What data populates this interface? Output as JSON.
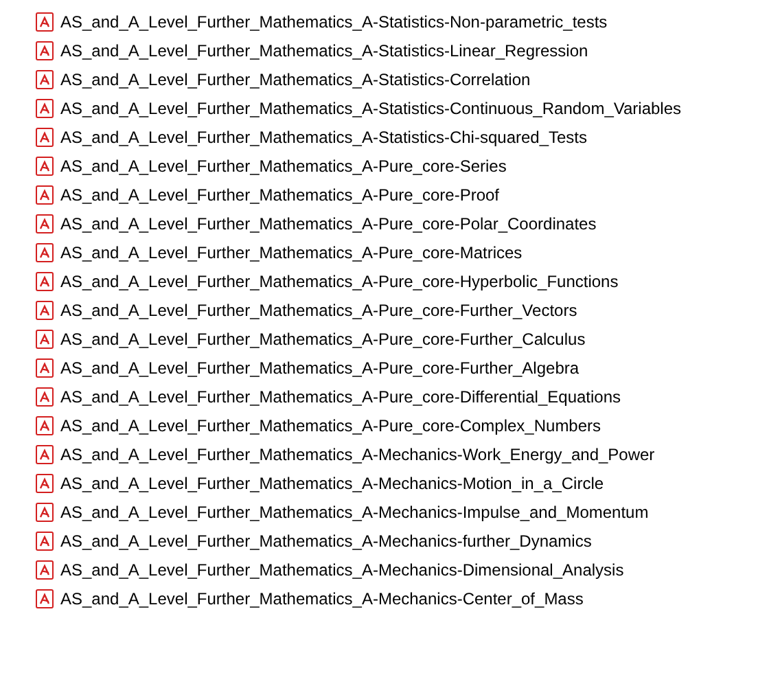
{
  "files": [
    {
      "name": "AS_and_A_Level_Further_Mathematics_A-Statistics-Non-parametric_tests"
    },
    {
      "name": "AS_and_A_Level_Further_Mathematics_A-Statistics-Linear_Regression"
    },
    {
      "name": "AS_and_A_Level_Further_Mathematics_A-Statistics-Correlation"
    },
    {
      "name": "AS_and_A_Level_Further_Mathematics_A-Statistics-Continuous_Random_Variables"
    },
    {
      "name": "AS_and_A_Level_Further_Mathematics_A-Statistics-Chi-squared_Tests"
    },
    {
      "name": "AS_and_A_Level_Further_Mathematics_A-Pure_core-Series"
    },
    {
      "name": "AS_and_A_Level_Further_Mathematics_A-Pure_core-Proof"
    },
    {
      "name": "AS_and_A_Level_Further_Mathematics_A-Pure_core-Polar_Coordinates"
    },
    {
      "name": "AS_and_A_Level_Further_Mathematics_A-Pure_core-Matrices"
    },
    {
      "name": "AS_and_A_Level_Further_Mathematics_A-Pure_core-Hyperbolic_Functions"
    },
    {
      "name": "AS_and_A_Level_Further_Mathematics_A-Pure_core-Further_Vectors"
    },
    {
      "name": "AS_and_A_Level_Further_Mathematics_A-Pure_core-Further_Calculus"
    },
    {
      "name": "AS_and_A_Level_Further_Mathematics_A-Pure_core-Further_Algebra"
    },
    {
      "name": "AS_and_A_Level_Further_Mathematics_A-Pure_core-Differential_Equations"
    },
    {
      "name": "AS_and_A_Level_Further_Mathematics_A-Pure_core-Complex_Numbers"
    },
    {
      "name": "AS_and_A_Level_Further_Mathematics_A-Mechanics-Work_Energy_and_Power"
    },
    {
      "name": "AS_and_A_Level_Further_Mathematics_A-Mechanics-Motion_in_a_Circle"
    },
    {
      "name": "AS_and_A_Level_Further_Mathematics_A-Mechanics-Impulse_and_Momentum"
    },
    {
      "name": "AS_and_A_Level_Further_Mathematics_A-Mechanics-further_Dynamics"
    },
    {
      "name": "AS_and_A_Level_Further_Mathematics_A-Mechanics-Dimensional_Analysis"
    },
    {
      "name": "AS_and_A_Level_Further_Mathematics_A-Mechanics-Center_of_Mass"
    }
  ]
}
